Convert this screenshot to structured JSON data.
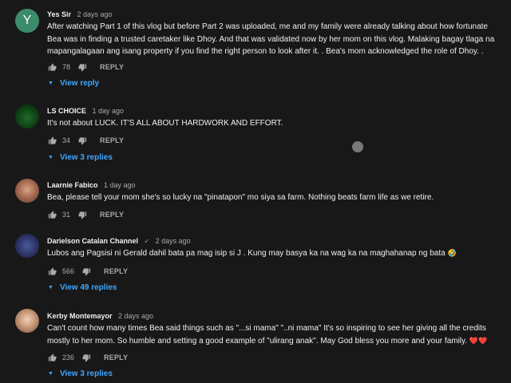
{
  "comments": [
    {
      "author": "Yes Sir",
      "avatar_letter": "Y",
      "verified": "",
      "time": "2 days ago",
      "text": "After watching Part 1 of this vlog but before Part 2 was uploaded, me and my family were already talking about how fortunate Bea was in finding  a trusted caretaker like Dhoy. And that was validated now by her mom on this vlog. Malaking bagay tlaga na mapangalagaan ang isang property if you find the right person to look after it. . Bea's mom acknowledged the role of Dhoy. .",
      "likes": "78",
      "reply_label": "REPLY",
      "view_replies": "View reply"
    },
    {
      "author": "LS CHOICE",
      "avatar_letter": "",
      "verified": "",
      "time": "1 day ago",
      "text": "It's not about LUCK. IT'S ALL ABOUT HARDWORK AND EFFORT.",
      "likes": "34",
      "reply_label": "REPLY",
      "view_replies": "View 3 replies"
    },
    {
      "author": "Laarnie Fabico",
      "avatar_letter": "",
      "verified": "",
      "time": "1 day ago",
      "text": "Bea, please tell your mom she's so lucky na \"pinatapon\" mo siya sa farm. Nothing beats farm life as we retire.",
      "likes": "31",
      "reply_label": "REPLY",
      "view_replies": ""
    },
    {
      "author": "Darielson Catalan Channel",
      "avatar_letter": "",
      "verified": "✓",
      "time": "2 days ago",
      "text": "Lubos ang Pagsisi ni Gerald dahil bata pa mag isip si J . Kung may basya ka na wag ka na maghahanap ng bata",
      "emoji": "🤣",
      "likes": "566",
      "reply_label": "REPLY",
      "view_replies": "View 49 replies"
    },
    {
      "author": "Kerby Montemayor",
      "avatar_letter": "",
      "verified": "",
      "time": "2 days ago",
      "text": "Can't count how many times Bea said things such as \"...si mama\" \"..ni mama\" It's so inspiring to see her giving all the credits mostly to her mom. So humble and setting a good example of \"ulirang anak\". May God bless you more and your family.",
      "emoji": "❤️❤️",
      "likes": "236",
      "reply_label": "REPLY",
      "view_replies": "View 3 replies"
    }
  ],
  "colors": {
    "background": "#181818",
    "text": "#f1f1f1",
    "secondary_text": "#aaaaaa",
    "link": "#3ea6ff"
  },
  "icons": {
    "like": "thumb-up-icon",
    "dislike": "thumb-down-icon",
    "expand": "chevron-down-icon"
  }
}
